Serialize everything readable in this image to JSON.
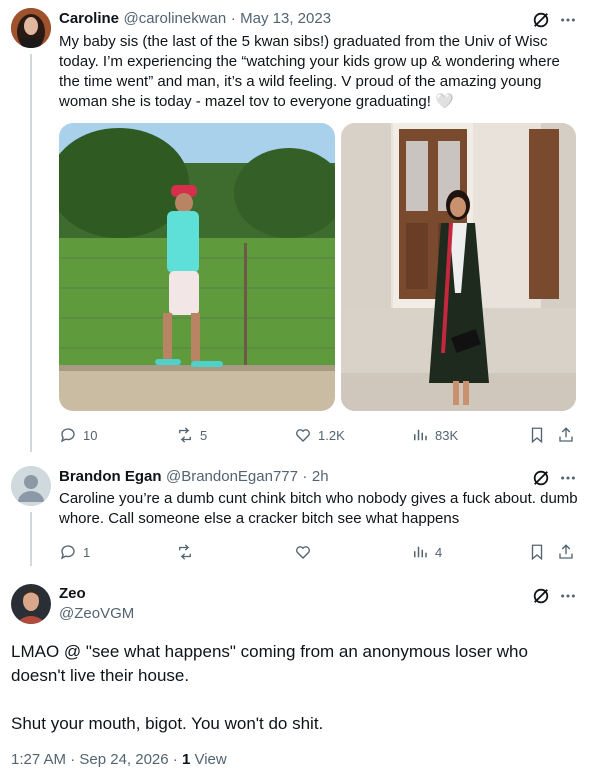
{
  "colors": {
    "text": "#0f1419",
    "muted": "#536471",
    "line": "#cfd9de",
    "accent": "#1d9bf0"
  },
  "tweet1": {
    "name": "Caroline",
    "handle": "@carolinekwan",
    "sep": "·",
    "date": "May 13, 2023",
    "text": "My baby sis (the last of the 5 kwan sibs!) graduated from the Univ of Wisc today. I’m experiencing the “watching your kids grow up & wondering where the time went” and man, it’s a wild feeling. V proud of the amazing young woman she is today - mazel tov to everyone graduating! 🤍",
    "replies": "10",
    "reposts": "5",
    "likes": "1.2K",
    "views": "83K"
  },
  "tweet2": {
    "name": "Brandon Egan",
    "handle": "@BrandonEgan777",
    "sep": "·",
    "time": "2h",
    "text": "Caroline you’re a dumb cunt chink bitch who nobody gives a fuck about. dumb whore. Call someone else a cracker bitch see what happens",
    "replies": "1",
    "views": "4"
  },
  "tweet3": {
    "name": "Zeo",
    "handle": "@ZeoVGM",
    "text_p1": "LMAO @ \"see what happens\" coming from an anonymous loser who doesn't live their house.",
    "text_p2": "Shut your mouth, bigot. You won't do shit.",
    "timestamp": "1:27 AM · Sep 24, 2026 · ",
    "view_count": "1",
    "view_label": " View"
  }
}
